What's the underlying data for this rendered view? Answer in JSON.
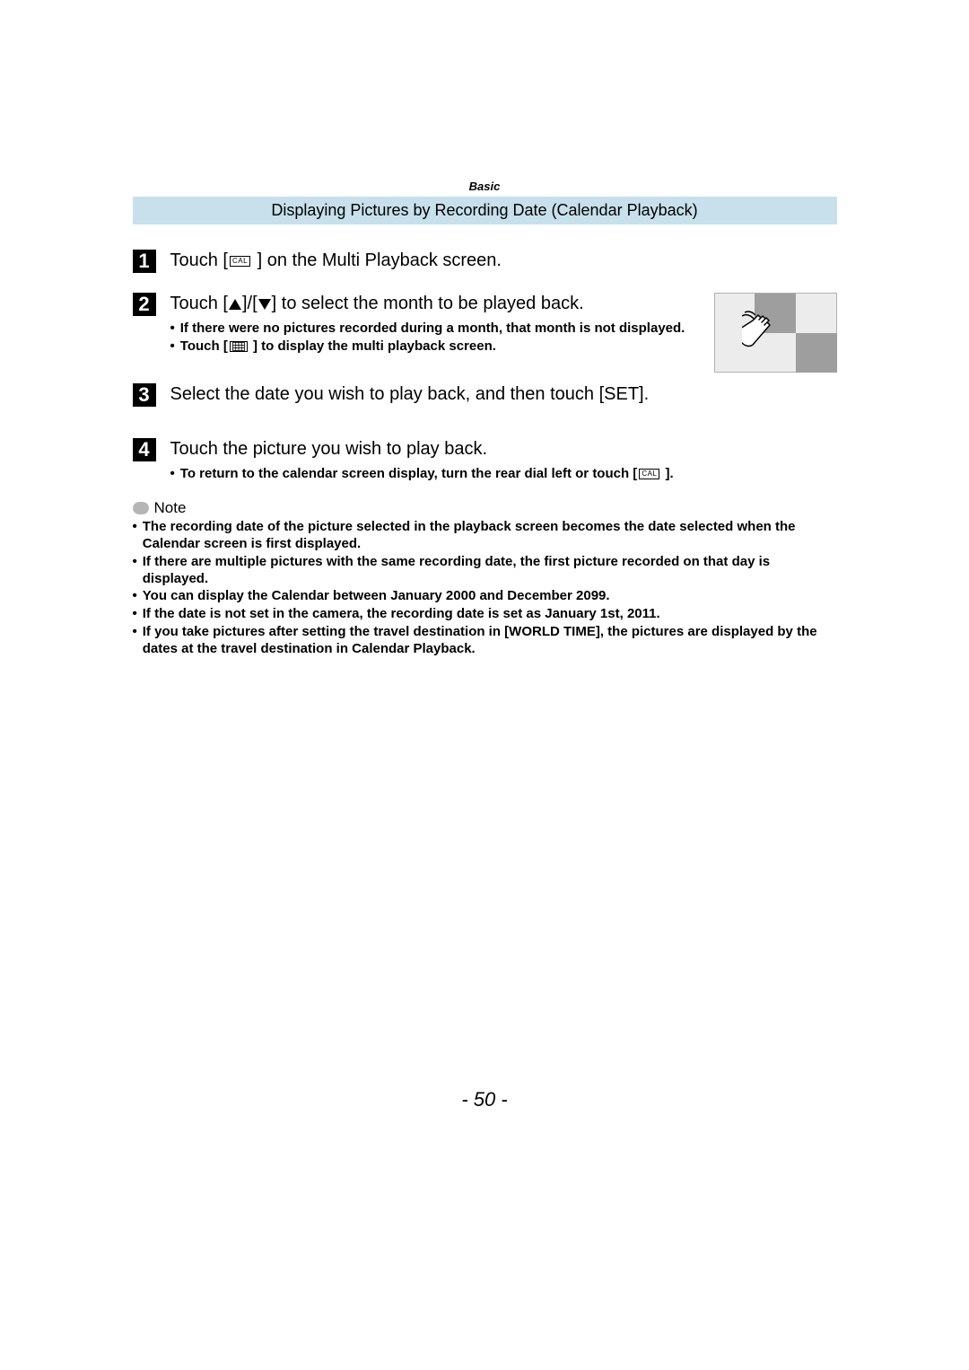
{
  "sectionLabel": "Basic",
  "bannerTitle": "Displaying Pictures by Recording Date (Calendar Playback)",
  "icons": {
    "cal": "CAL"
  },
  "steps": [
    {
      "num": "1",
      "main_pre": "Touch [",
      "main_post": " ] on the Multi Playback screen."
    },
    {
      "num": "2",
      "main_pre": "Touch [",
      "main_mid": "]/[",
      "main_post": "] to select the month to be played back.",
      "bullets": [
        {
          "text": "If there were no pictures recorded during a month, that month is not displayed."
        },
        {
          "pre": "Touch [",
          "post": " ] to display the multi playback screen."
        }
      ]
    },
    {
      "num": "3",
      "main": "Select the date you wish to play back, and then touch [SET]."
    },
    {
      "num": "4",
      "main": "Touch the picture you wish to play back.",
      "bullets": [
        {
          "pre": "To return to the calendar screen display, turn the rear dial left or touch [",
          "post": " ]."
        }
      ]
    }
  ],
  "noteLabel": "Note",
  "notes": [
    "The recording date of the picture selected in the playback screen becomes the date selected when the Calendar screen is first displayed.",
    "If there are multiple pictures with the same recording date, the first picture recorded on that day is displayed.",
    "You can display the Calendar between January 2000 and December 2099.",
    "If the date is not set in the camera, the recording date is set as January 1st, 2011.",
    "If you take pictures after setting the travel destination in [WORLD TIME], the pictures are displayed by the dates at the travel destination in Calendar Playback."
  ],
  "pageNumber": "- 50 -"
}
